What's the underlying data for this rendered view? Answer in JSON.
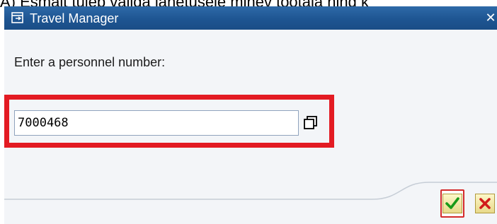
{
  "caption": "A) Esmalt tuleb valida lähetusele minev töötaja ning k",
  "dialog": {
    "title": "Travel Manager",
    "close_symbol": "✕",
    "prompt": "Enter a personnel number:",
    "personnel_number": {
      "value": "7000468"
    },
    "buttons": {
      "ok": "continue-checkmark-icon",
      "cancel": "cancel-x-icon"
    }
  },
  "colors": {
    "titlebar": "#1e5592",
    "highlight_frame": "#e31b23",
    "dialog_bg": "#f3f5f8"
  }
}
